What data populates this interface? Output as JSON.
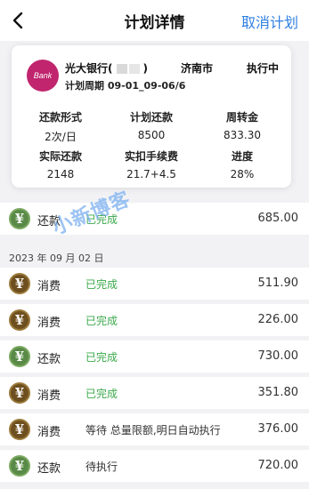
{
  "header": {
    "title": "计划详情",
    "cancel_label": "取消计划"
  },
  "plan": {
    "bank_logo_text": "Bank",
    "bank_name": "光大银行(",
    "bank_name_close": ")",
    "city": "济南市",
    "exec_status": "执行中",
    "period": "计划周期 09-01_09-06/6",
    "metrics": [
      {
        "label": "还款形式",
        "value": "2次/日"
      },
      {
        "label": "计划还款",
        "value": "8500"
      },
      {
        "label": "周转金",
        "value": "833.30"
      },
      {
        "label": "实际还款",
        "value": "2148"
      },
      {
        "label": "实扣手续费",
        "value": "21.7+4.5"
      },
      {
        "label": "进度",
        "value": "28%"
      }
    ]
  },
  "watermark": "小新博客",
  "transactions_top": [
    {
      "kind": "还款",
      "status": "已完成",
      "amount": "685.00",
      "type": "repay",
      "state": "done"
    }
  ],
  "date_header": "2023 年 09 月 02 日",
  "transactions": [
    {
      "kind": "消费",
      "status": "已完成",
      "amount": "511.90",
      "type": "spend",
      "state": "done"
    },
    {
      "kind": "消费",
      "status": "已完成",
      "amount": "226.00",
      "type": "spend",
      "state": "done"
    },
    {
      "kind": "还款",
      "status": "已完成",
      "amount": "730.00",
      "type": "repay",
      "state": "done"
    },
    {
      "kind": "消费",
      "status": "已完成",
      "amount": "351.80",
      "type": "spend",
      "state": "done"
    },
    {
      "kind": "消费",
      "status": "等待 总量限额,明日自动执行",
      "amount": "376.00",
      "type": "spend",
      "state": "wait"
    },
    {
      "kind": "还款",
      "status": "待执行",
      "amount": "720.00",
      "type": "repay",
      "state": "wait"
    }
  ],
  "colors": {
    "accent": "#2f7fe0",
    "done": "#3aa84a",
    "bank": "#c0256e",
    "repay_coin": "#5a8a47",
    "spend_coin": "#6e4f1f"
  },
  "icons": {
    "back": "chevron-left-icon",
    "coin": "yen-coin-icon"
  }
}
